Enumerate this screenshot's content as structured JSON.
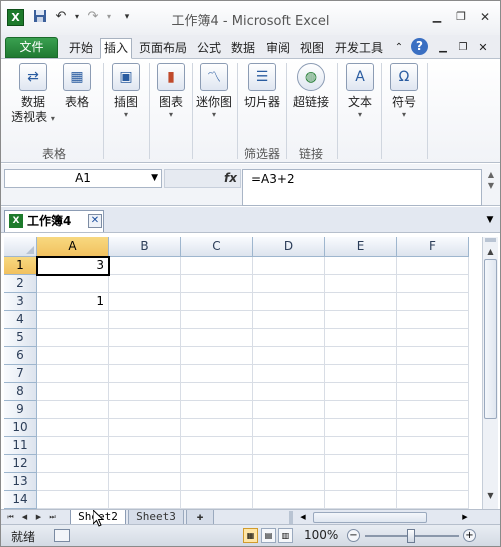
{
  "window": {
    "title": "工作簿4 - Microsoft Excel",
    "app_icon": "X"
  },
  "quick_access": {
    "save_icon": "save-icon",
    "undo_icon": "undo-icon",
    "redo_icon": "redo-icon",
    "customize_icon": "customize-qat-icon"
  },
  "ribbon_tabs": [
    "文件",
    "开始",
    "插入",
    "页面布局",
    "公式",
    "数据",
    "审阅",
    "视图",
    "开发工具"
  ],
  "ribbon_right": {
    "collapse_icon": "ribbon-collapse-icon",
    "help": "?"
  },
  "ribbon": {
    "groups": [
      {
        "label": "表格",
        "buttons": [
          {
            "icon": "pivot-table-icon",
            "label_line1": "数据",
            "label_line2": "透视表"
          },
          {
            "icon": "table-icon",
            "label_line1": "表格"
          }
        ]
      },
      {
        "label": "",
        "buttons": [
          {
            "icon": "illustration-icon",
            "label_line1": "插图"
          }
        ]
      },
      {
        "label": "",
        "buttons": [
          {
            "icon": "chart-icon",
            "label_line1": "图表"
          }
        ]
      },
      {
        "label": "",
        "buttons": [
          {
            "icon": "sparkline-icon",
            "label_line1": "迷你图"
          }
        ]
      },
      {
        "label": "筛选器",
        "buttons": [
          {
            "icon": "slicer-icon",
            "label_line1": "切片器"
          }
        ]
      },
      {
        "label": "链接",
        "buttons": [
          {
            "icon": "hyperlink-icon",
            "label_line1": "超链接"
          }
        ]
      },
      {
        "label": "",
        "buttons": [
          {
            "icon": "text-icon",
            "label_line1": "文本"
          }
        ]
      },
      {
        "label": "",
        "buttons": [
          {
            "icon": "symbol-icon",
            "label_line1": "符号",
            "glyph": "Ω"
          }
        ]
      }
    ]
  },
  "formula_bar": {
    "name_box": "A1",
    "fx": "fx",
    "formula": "=A3+2"
  },
  "workbook_tab": {
    "label": "工作簿4"
  },
  "sheet": {
    "columns": [
      "A",
      "B",
      "C",
      "D",
      "E",
      "F"
    ],
    "rows": [
      "1",
      "2",
      "3",
      "4",
      "5",
      "6",
      "7",
      "8",
      "9",
      "10",
      "11",
      "12",
      "13",
      "14"
    ],
    "cells": [
      {
        "row": 1,
        "col": 0,
        "value": "3"
      },
      {
        "row": 3,
        "col": 0,
        "value": "1"
      }
    ],
    "selected": "A1"
  },
  "sheet_tabs": [
    "Sheet2",
    "Sheet3"
  ],
  "status_bar": {
    "ready": "就绪",
    "zoom": "100%"
  },
  "colors": {
    "file_tab": "#1f7a32",
    "header_fill": "#dde4ee",
    "selected_header": "#f1c15f"
  }
}
